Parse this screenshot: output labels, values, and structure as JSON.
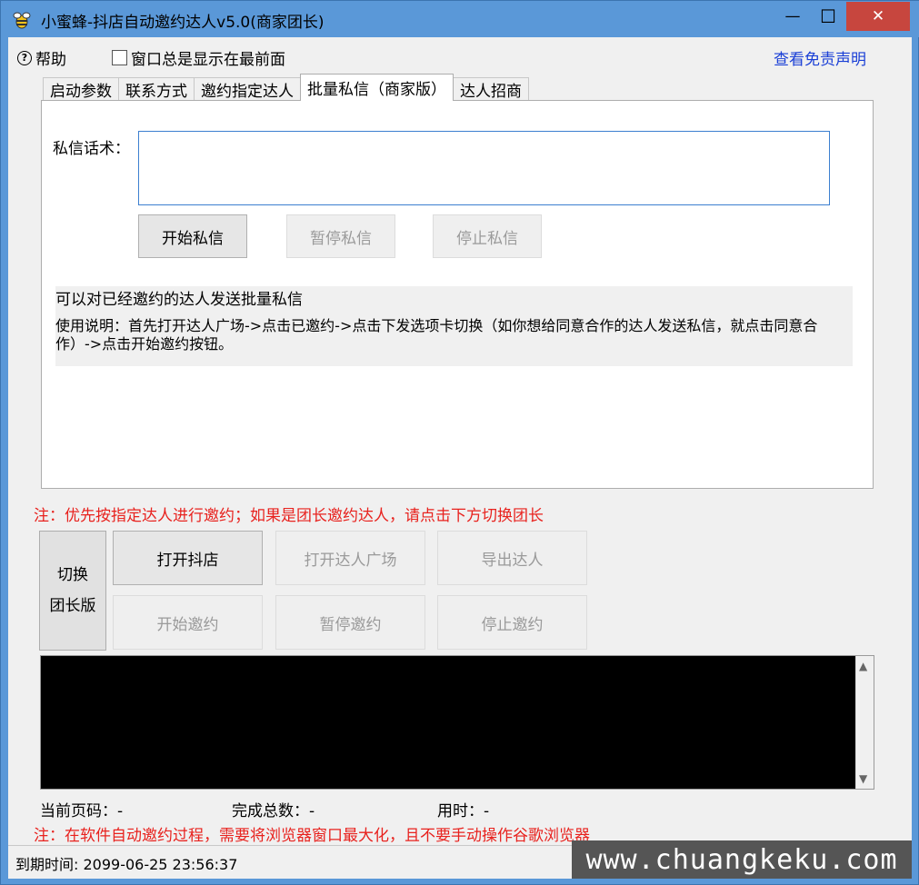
{
  "window": {
    "title": "小蜜蜂-抖店自动邀约达人v5.0(商家团长)",
    "minimize": "—",
    "maximize": "☐",
    "close": "✕"
  },
  "toolbar": {
    "help": "帮助",
    "always_on_top": "窗口总是显示在最前面",
    "disclaimer": "查看免责声明"
  },
  "tabs": [
    {
      "label": "启动参数"
    },
    {
      "label": "联系方式"
    },
    {
      "label": "邀约指定达人"
    },
    {
      "label": "批量私信（商家版）"
    },
    {
      "label": "达人招商"
    }
  ],
  "panel": {
    "script_label": "私信话术：",
    "script_value": "",
    "start_dm": "开始私信",
    "pause_dm": "暂停私信",
    "stop_dm": "停止私信",
    "info_line1": "可以对已经邀约的达人发送批量私信",
    "info_line2": "使用说明：首先打开达人广场->点击已邀约->点击下发选项卡切换（如你想给同意合作的达人发送私信，就点击同意合作）->点击开始邀约按钮。"
  },
  "bottom": {
    "note1": "注：优先按指定达人进行邀约；如果是团长邀约达人，请点击下方切换团长",
    "switch_line1": "切换",
    "switch_line2": "团长版",
    "open_shop": "打开抖店",
    "open_plaza": "打开达人广场",
    "export": "导出达人",
    "start_invite": "开始邀约",
    "pause_invite": "暂停邀约",
    "stop_invite": "停止邀约",
    "current_page_label": "当前页码：",
    "current_page_value": "-",
    "total_label": "完成总数：",
    "total_value": "-",
    "time_label": "用时：",
    "time_value": "-",
    "note2": "注：在软件自动邀约过程，需要将浏览器窗口最大化，且不要手动操作谷歌浏览器"
  },
  "status": {
    "expiry": "到期时间: 2099-06-25 23:56:37",
    "watermark": "www.chuangkeku.com"
  }
}
